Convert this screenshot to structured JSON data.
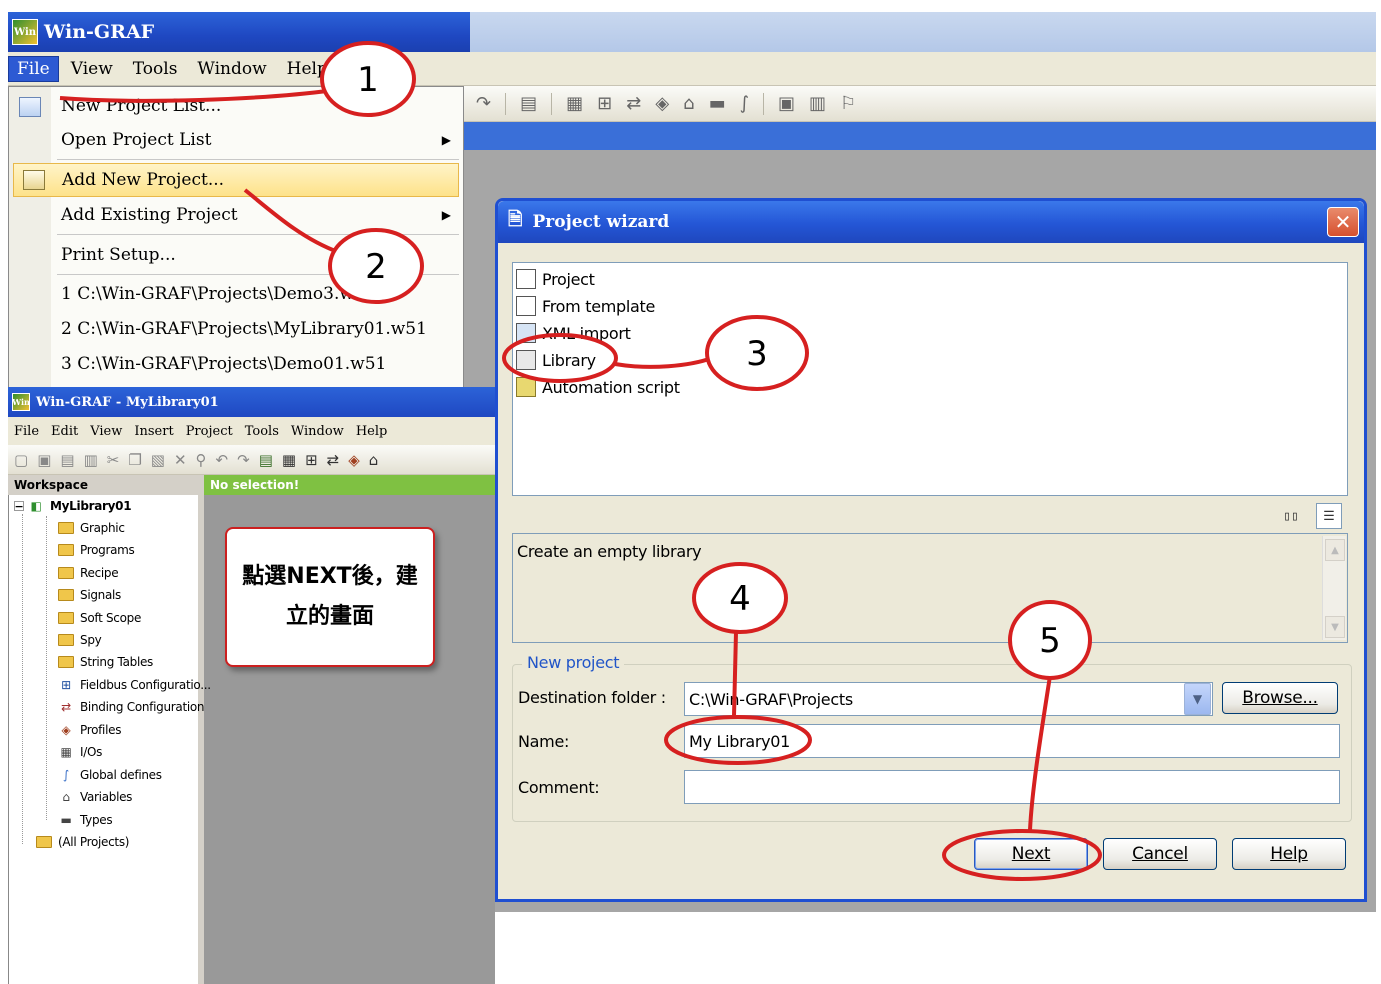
{
  "main_window": {
    "app_logo": "Win",
    "title": "Win-GRAF",
    "menu": [
      "File",
      "View",
      "Tools",
      "Window",
      "Help"
    ]
  },
  "file_menu": {
    "items": [
      {
        "label": "New Project List...",
        "submenu": false
      },
      {
        "label": "Open Project List",
        "submenu": true
      },
      {
        "label": "Add New Project...",
        "submenu": false,
        "highlighted": true
      },
      {
        "label": "Add Existing Project",
        "submenu": true
      },
      {
        "label": "Print Setup...",
        "submenu": false
      },
      {
        "label": "1 C:\\Win-GRAF\\Projects\\Demo3.w51",
        "submenu": false
      },
      {
        "label": "2 C:\\Win-GRAF\\Projects\\MyLibrary01.w51",
        "submenu": false
      },
      {
        "label": "3 C:\\Win-GRAF\\Projects\\Demo01.w51",
        "submenu": false
      }
    ]
  },
  "library_window": {
    "title": "Win-GRAF  - MyLibrary01",
    "menu": [
      "File",
      "Edit",
      "View",
      "Insert",
      "Project",
      "Tools",
      "Window",
      "Help"
    ],
    "workspace_label": "Workspace",
    "no_selection": "No selection!",
    "tree_root": "MyLibrary01",
    "tree_children": [
      {
        "label": "Graphic",
        "icon": "folder-icon"
      },
      {
        "label": "Programs",
        "icon": "folder-icon"
      },
      {
        "label": "Recipe",
        "icon": "folder-icon"
      },
      {
        "label": "Signals",
        "icon": "folder-icon"
      },
      {
        "label": "Soft Scope",
        "icon": "folder-icon"
      },
      {
        "label": "Spy",
        "icon": "folder-icon"
      },
      {
        "label": "String Tables",
        "icon": "folder-icon"
      },
      {
        "label": "Fieldbus Configuratio...",
        "icon": "fieldbus-icon"
      },
      {
        "label": "Binding Configuration",
        "icon": "binding-icon"
      },
      {
        "label": "Profiles",
        "icon": "profiles-icon"
      },
      {
        "label": "I/Os",
        "icon": "ios-icon"
      },
      {
        "label": "Global defines",
        "icon": "defines-icon"
      },
      {
        "label": "Variables",
        "icon": "variables-icon"
      },
      {
        "label": "Types",
        "icon": "types-icon"
      }
    ],
    "tree_bottom": "(All Projects)"
  },
  "note": "點選NEXT後，建立的畫面",
  "wizard": {
    "title": "Project wizard",
    "types": [
      "Project",
      "From template",
      "XML import",
      "Library",
      "Automation script"
    ],
    "description": "Create an empty library",
    "group_label": "New project",
    "destination_label": "Destination folder :",
    "destination_value": "C:\\Win-GRAF\\Projects",
    "name_label": "Name:",
    "name_value": "My Library01",
    "comment_label": "Comment:",
    "comment_value": "",
    "browse_label": "Browse...",
    "next_label": "Next",
    "cancel_label": "Cancel",
    "help_label": "Help"
  },
  "annotations": {
    "steps": [
      "1",
      "2",
      "3",
      "4",
      "5"
    ],
    "color": "#d62020"
  }
}
